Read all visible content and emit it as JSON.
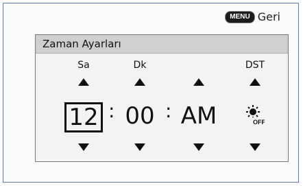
{
  "header": {
    "menu_button": "MENU",
    "back_label": "Geri"
  },
  "panel": {
    "title": "Zaman Ayarları",
    "columns": [
      {
        "label": "Sa",
        "value": "12"
      },
      {
        "label": "Dk",
        "value": "00"
      },
      {
        "label": "",
        "value": "AM"
      },
      {
        "label": "DST",
        "value": "",
        "icon": "dst-off-icon"
      }
    ],
    "separator": ":"
  }
}
